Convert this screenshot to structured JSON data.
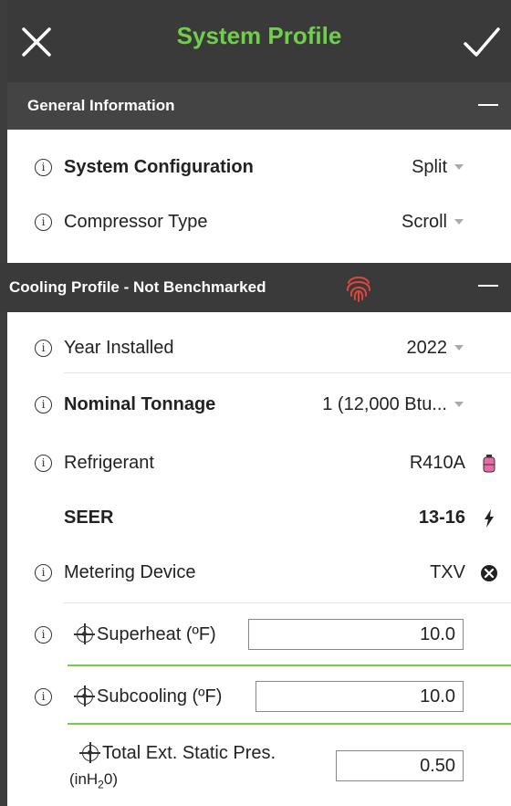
{
  "header": {
    "title": "System Profile",
    "close_icon": "close-icon",
    "confirm_icon": "check-icon"
  },
  "general": {
    "title": "General Information",
    "rows": [
      {
        "label": "System Configuration",
        "value": "Split",
        "bold": true
      },
      {
        "label": "Compressor Type",
        "value": "Scroll",
        "bold": false
      }
    ]
  },
  "cooling": {
    "title": "Cooling Profile - Not Benchmarked",
    "status_icon": "fingerprint-icon",
    "status_color": "#e0463a",
    "year": {
      "label": "Year Installed",
      "value": "2022"
    },
    "tonnage": {
      "label": "Nominal Tonnage",
      "value": "1 (12,000 Btu..."
    },
    "refrigerant": {
      "label": "Refrigerant",
      "value": "R410A",
      "icon": "refrigerant-tank-icon",
      "icon_color": "#e96aa7"
    },
    "seer": {
      "label": "SEER",
      "value": "13-16",
      "icon": "lightning-icon"
    },
    "metering": {
      "label": "Metering Device",
      "value": "TXV",
      "icon": "close-circle-icon"
    },
    "superheat": {
      "label": "Superheat (ºF)",
      "value": "10.0"
    },
    "subcooling": {
      "label": "Subcooling  (ºF)",
      "value": "10.0"
    },
    "static": {
      "label": "Total Ext. Static Pres.",
      "unit": "(inH",
      "unit_sub": "2",
      "unit_end": "0)",
      "value": "0.50"
    }
  },
  "colors": {
    "accent": "#6fcf4a",
    "bar": "#3a3a3a"
  }
}
